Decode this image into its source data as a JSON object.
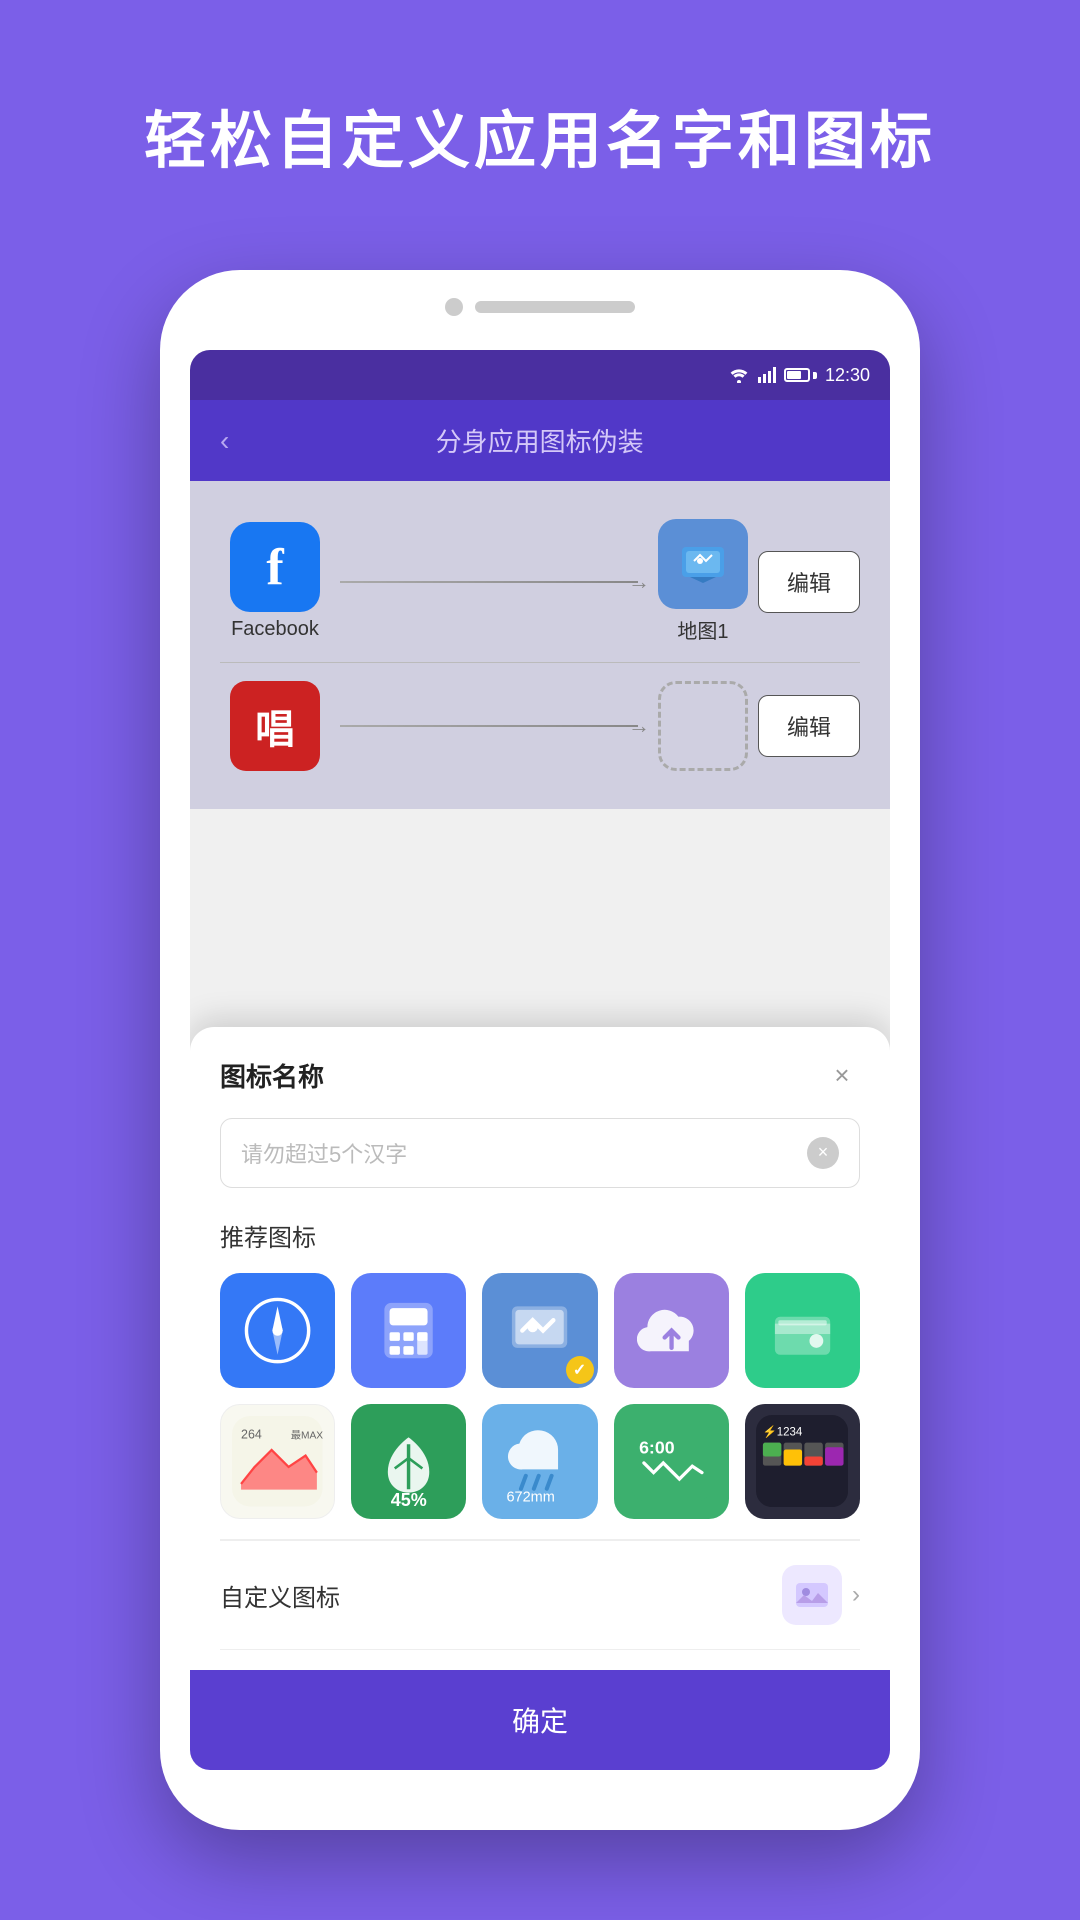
{
  "page": {
    "bg_color": "#7B5FE8",
    "title": "轻松自定义应用名字和图标"
  },
  "status_bar": {
    "time": "12:30"
  },
  "app_header": {
    "back": "‹",
    "title": "分身应用图标伪装"
  },
  "app_rows": [
    {
      "source_icon": "F",
      "source_label": "Facebook",
      "source_bg": "#1877F2",
      "dest_icon": "🗺",
      "dest_label": "地图1",
      "has_dest": true,
      "edit_label": "编辑"
    },
    {
      "source_icon": "唱",
      "source_label": "",
      "source_bg": "#cc2222",
      "dest_icon": "",
      "dest_label": "",
      "has_dest": false,
      "edit_label": "编辑"
    }
  ],
  "modal": {
    "title": "图标名称",
    "close_icon": "×",
    "input_placeholder": "请勿超过5个汉字",
    "clear_icon": "×",
    "section_recommended": "推荐图标",
    "section_custom": "自定义图标",
    "confirm_label": "确定",
    "recommended_icons": [
      {
        "type": "compass",
        "bg": "#3478F6",
        "label": "compass"
      },
      {
        "type": "calc",
        "bg": "#5C7CFA",
        "label": "calculator"
      },
      {
        "type": "maps",
        "bg": "#5B8FD6",
        "label": "maps",
        "selected": true
      },
      {
        "type": "cloud",
        "bg": "#9B80E0",
        "label": "cloud-upload"
      },
      {
        "type": "wallet",
        "bg": "#2ECC8A",
        "label": "wallet"
      },
      {
        "type": "chart",
        "bg": "#f8f8f0",
        "label": "chart"
      },
      {
        "type": "leaf",
        "bg": "#2d9e5a",
        "label": "leaf"
      },
      {
        "type": "rain",
        "bg": "#6ab0e8",
        "label": "rain"
      },
      {
        "type": "alarm",
        "bg": "#3cb06e",
        "label": "alarm"
      },
      {
        "type": "battery",
        "bg": "#2c2c3e",
        "label": "battery"
      }
    ]
  }
}
